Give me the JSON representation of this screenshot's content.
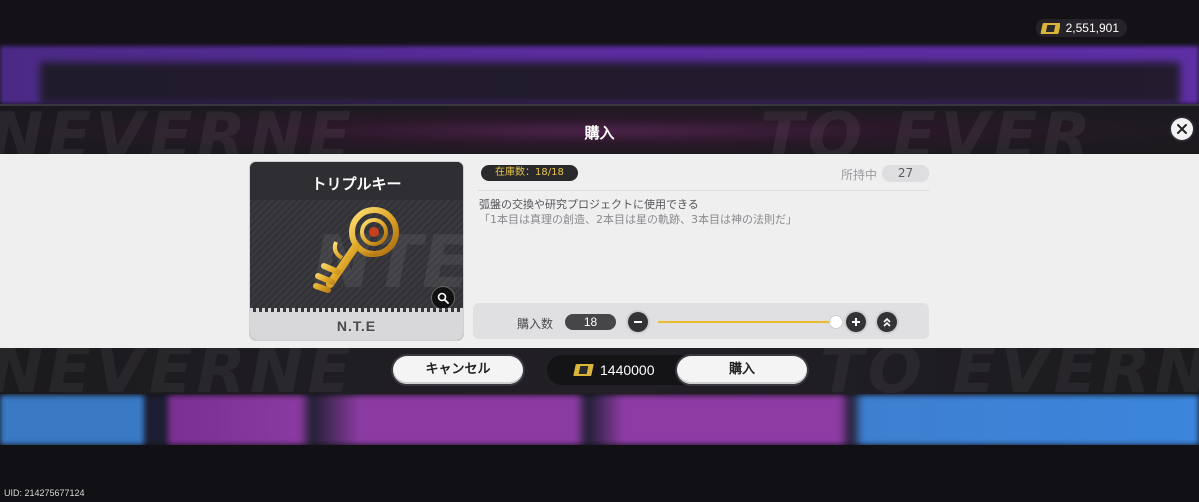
{
  "header": {
    "currency_amount": "2,551,901",
    "currency_icon": "ticket-icon"
  },
  "modal": {
    "title": "購入",
    "close_icon": "close-icon"
  },
  "item": {
    "name": "トリプルキー",
    "brand": "N.T.E",
    "icon": "golden-key-icon",
    "stock_label": "在庫数：18/18",
    "owned_label": "所持中",
    "owned_value": "27",
    "description": "弧盤の交換や研究プロジェクトに使用できる",
    "flavor": "「1本目は真理の創造、2本目は星の軌跡、3本目は神の法則だ」"
  },
  "quantity": {
    "label": "購入数",
    "value": "18",
    "current": 18,
    "max": 18,
    "accent_color": "#e9bd2f"
  },
  "actions": {
    "cancel_label": "キャンセル",
    "buy_label": "購入",
    "price": "1440000"
  },
  "footer": {
    "uid": "UID: 214275677124"
  }
}
